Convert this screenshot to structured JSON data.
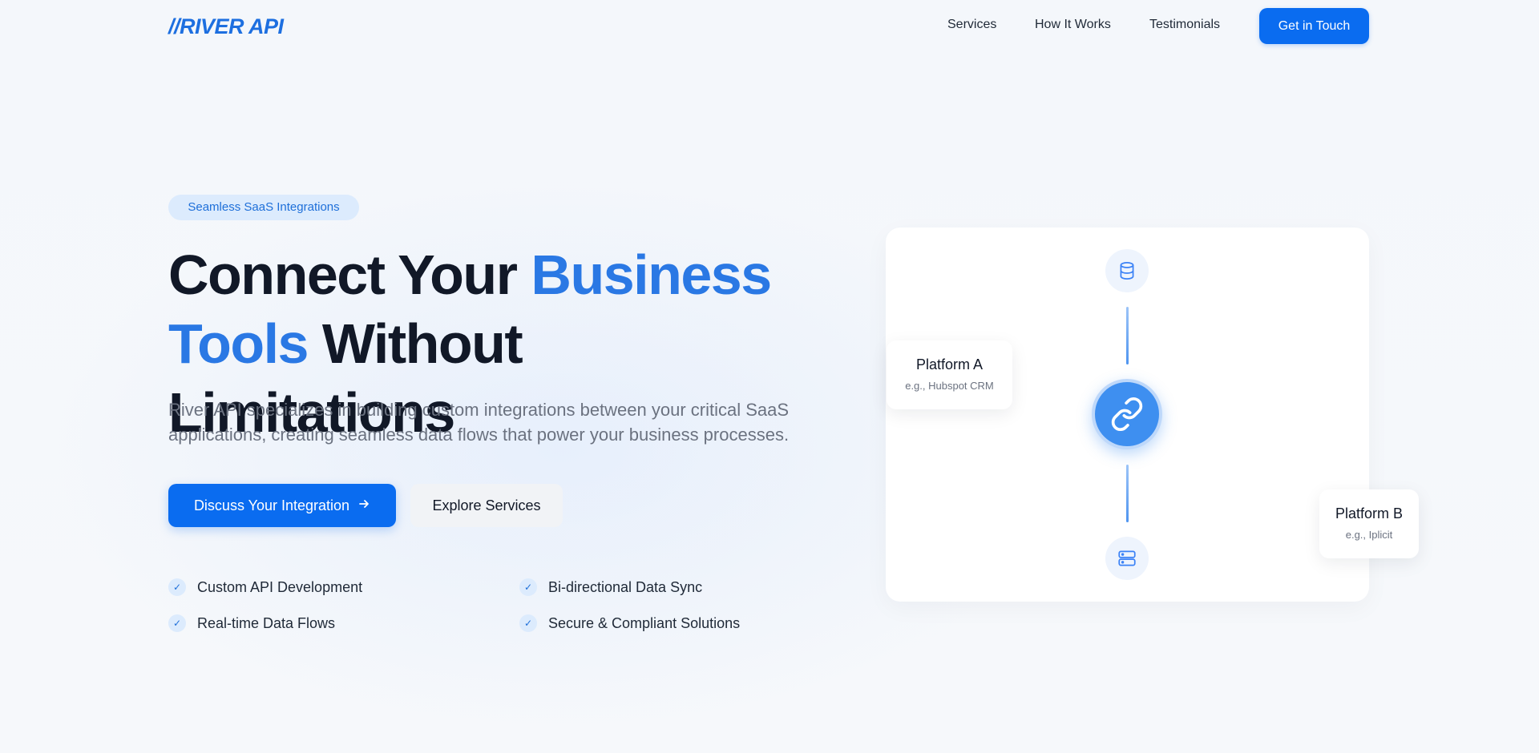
{
  "header": {
    "logo": "//RIVER API",
    "nav": [
      {
        "label": "Services"
      },
      {
        "label": "How It Works"
      },
      {
        "label": "Testimonials"
      }
    ],
    "cta_label": "Get in Touch"
  },
  "hero": {
    "badge": "Seamless SaaS Integrations",
    "headline": {
      "part1": "Connect Your ",
      "accent1": "Business",
      "accent2": "Tools",
      "part2": " Without Limitations"
    },
    "lead": "River API specializes in building custom integrations between your critical SaaS applications, creating seamless data flows that power your business processes.",
    "primary_button": "Discuss Your Integration",
    "secondary_button": "Explore Services",
    "features": [
      {
        "label": "Custom API Development"
      },
      {
        "label": "Bi-directional Data Sync"
      },
      {
        "label": "Real-time Data Flows"
      },
      {
        "label": "Secure & Compliant Solutions"
      }
    ]
  },
  "diagram": {
    "platform_a": {
      "name": "Platform A",
      "example": "e.g., Hubspot CRM"
    },
    "platform_b": {
      "name": "Platform B",
      "example": "e.g., Iplicit"
    },
    "icons": {
      "top": "database-icon",
      "center": "link-icon",
      "bottom": "server-icon"
    }
  },
  "colors": {
    "brand": "#0a6cf0",
    "accent_text": "#2a78e4",
    "hub": "#3e8ff0",
    "badge_bg": "#dcebfd"
  }
}
